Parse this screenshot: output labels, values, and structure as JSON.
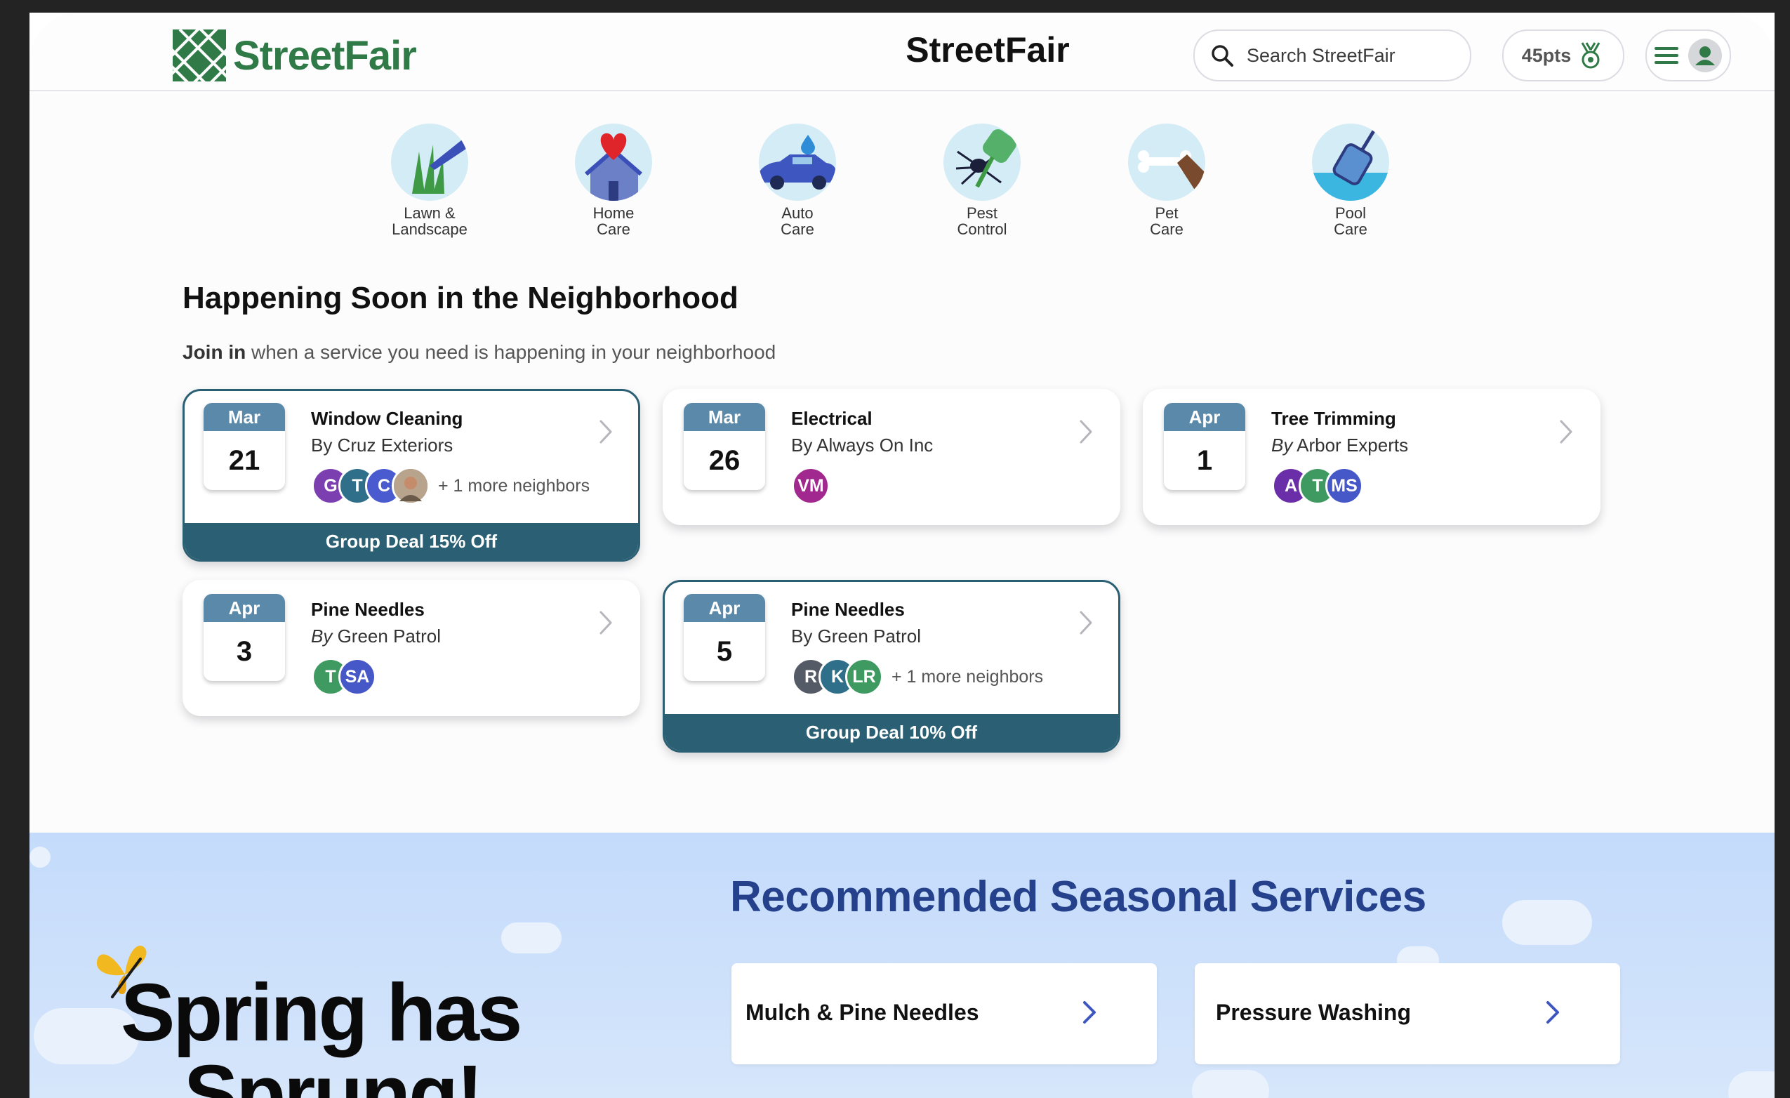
{
  "header": {
    "logo_text": "StreetFair",
    "title": "StreetFair",
    "search_placeholder": "Search StreetFair",
    "points": "45pts"
  },
  "categories": [
    {
      "label": "Lawn &\nLandscape",
      "icon": "lawn-icon"
    },
    {
      "label": "Home\nCare",
      "icon": "home-icon"
    },
    {
      "label": "Auto\nCare",
      "icon": "car-icon"
    },
    {
      "label": "Pest\nControl",
      "icon": "pest-icon"
    },
    {
      "label": "Pet\nCare",
      "icon": "pet-icon"
    },
    {
      "label": "Pool\nCare",
      "icon": "pool-icon"
    }
  ],
  "happening": {
    "title": "Happening Soon in the Neighborhood",
    "subtitle_bold": "Join in",
    "subtitle_rest": " when a service you need is happening in your neighborhood"
  },
  "events": [
    {
      "month": "Mar",
      "day": "21",
      "title": "Window Cleaning",
      "by_prefix": "By",
      "provider": "Cruz Exteriors",
      "avatars": [
        {
          "t": "G",
          "c": "#7b3fb0"
        },
        {
          "t": "T",
          "c": "#2f6f8a"
        },
        {
          "t": "C",
          "c": "#4a5bd0"
        },
        {
          "t": "",
          "c": "#8a7a6a"
        }
      ],
      "more": "+ 1 more neighbors",
      "deal": "Group Deal 15% Off"
    },
    {
      "month": "Mar",
      "day": "26",
      "title": "Electrical",
      "by_prefix": "By",
      "provider": "Always On Inc",
      "avatars": [
        {
          "t": "VM",
          "c": "#a0288f"
        }
      ],
      "more": "",
      "deal": ""
    },
    {
      "month": "Apr",
      "day": "1",
      "title": "Tree Trimming",
      "by_prefix": "By",
      "provider": "Arbor Experts",
      "avatars": [
        {
          "t": "A",
          "c": "#6a2fa8"
        },
        {
          "t": "T",
          "c": "#3f9a62"
        },
        {
          "t": "MS",
          "c": "#4658c8"
        }
      ],
      "more": "",
      "deal": ""
    },
    {
      "month": "Apr",
      "day": "3",
      "title": "Pine Needles",
      "by_prefix": "By",
      "provider": "Green Patrol",
      "avatars": [
        {
          "t": "T",
          "c": "#3f9a62"
        },
        {
          "t": "SA",
          "c": "#4658c8"
        }
      ],
      "more": "",
      "deal": ""
    },
    {
      "month": "Apr",
      "day": "5",
      "title": "Pine Needles",
      "by_prefix": "By",
      "provider": "Green Patrol",
      "avatars": [
        {
          "t": "R",
          "c": "#555b66"
        },
        {
          "t": "K",
          "c": "#2f6f8a"
        },
        {
          "t": "LR",
          "c": "#3f9a62"
        }
      ],
      "more": "+ 1 more neighbors",
      "deal": "Group Deal 10% Off"
    }
  ],
  "seasonal": {
    "title": "Recommended Seasonal Services",
    "hero_line1": "Spring has",
    "hero_line2": "Sprung!",
    "services": [
      "Mulch & Pine Needles",
      "Pressure Washing"
    ]
  },
  "colors": {
    "brand_green": "#2f7a47",
    "deal_teal": "#2b5f73",
    "calendar_blue": "#5b89aa",
    "seasonal_navy": "#25418c"
  }
}
